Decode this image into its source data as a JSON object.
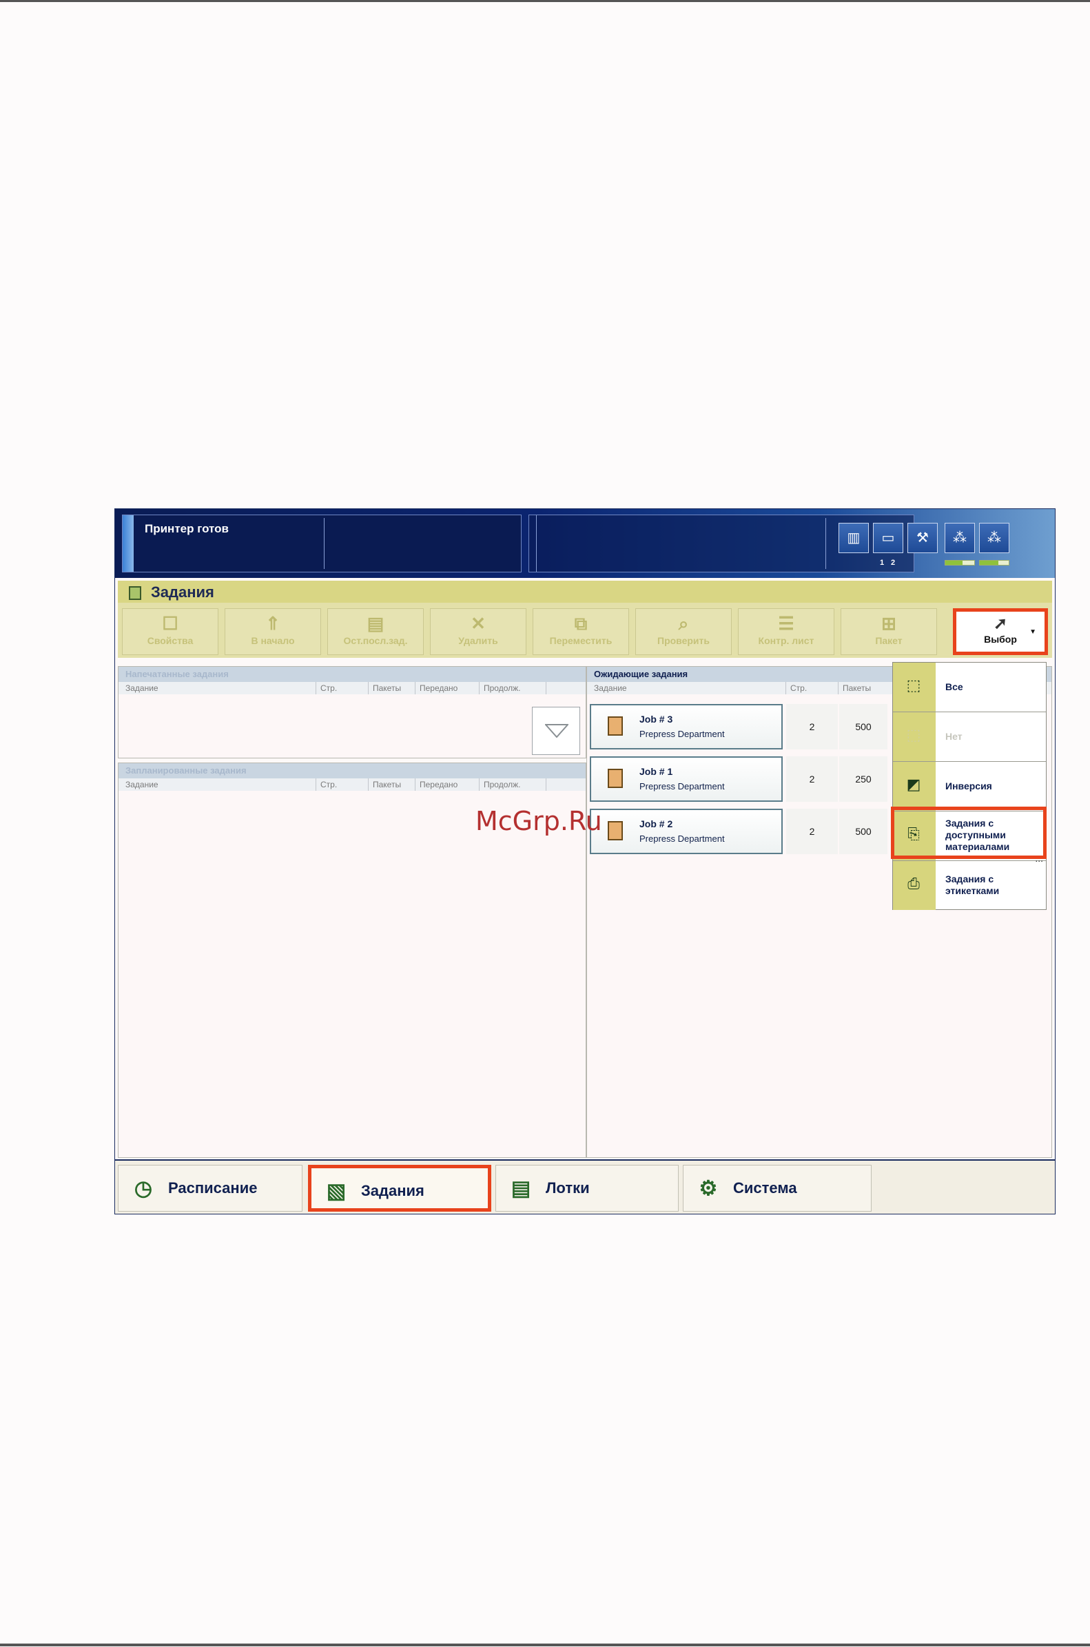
{
  "status": {
    "text": "Принтер готов",
    "tray_numbers": [
      "1",
      "2"
    ],
    "level_1": 0.6,
    "level_2": 0.65
  },
  "section": {
    "title": "Задания"
  },
  "toolbar": {
    "buttons": [
      {
        "label": "Свойства",
        "icon": "properties-icon"
      },
      {
        "label": "В начало",
        "icon": "to-top-icon"
      },
      {
        "label": "Ост.посл.зад.",
        "icon": "stop-after-job-icon"
      },
      {
        "label": "Удалить",
        "icon": "delete-icon"
      },
      {
        "label": "Переместить",
        "icon": "move-icon"
      },
      {
        "label": "Проверить",
        "icon": "check-icon"
      },
      {
        "label": "Контр. лист",
        "icon": "proof-sheet-icon"
      },
      {
        "label": "Пакет",
        "icon": "batch-icon"
      }
    ],
    "select": {
      "label": "Выбор",
      "icon": "cursor-icon"
    }
  },
  "printed": {
    "title": "Напечатанные задания",
    "columns": [
      "Задание",
      "Стр.",
      "Пакеты",
      "Передано",
      "Продолж."
    ]
  },
  "scheduled": {
    "title": "Запланированные задания",
    "columns": [
      "Задание",
      "Стр.",
      "Пакеты",
      "Передано",
      "Продолж."
    ]
  },
  "waiting": {
    "title": "Ожидающие задания",
    "columns": [
      "Задание",
      "Стр.",
      "Пакеты"
    ],
    "jobs": [
      {
        "name": "Job # 3",
        "dept": "Prepress Department",
        "pages": "2",
        "packs": "500"
      },
      {
        "name": "Job # 1",
        "dept": "Prepress Department",
        "pages": "2",
        "packs": "250"
      },
      {
        "name": "Job # 2",
        "dept": "Prepress Department",
        "pages": "2",
        "packs": "500"
      }
    ]
  },
  "dropdown": {
    "items": [
      {
        "label": "Все",
        "icon": "select-all-icon"
      },
      {
        "label": "Нет",
        "icon": "select-none-icon"
      },
      {
        "label": "Инверсия",
        "icon": "invert-selection-icon"
      },
      {
        "label": "Задания с доступными материалами",
        "icon": "available-media-icon"
      },
      {
        "label": "Задания с этикетками",
        "icon": "labels-icon"
      }
    ],
    "more": "..."
  },
  "nav": {
    "tabs": [
      {
        "label": "Расписание",
        "icon": "clock-icon"
      },
      {
        "label": "Задания",
        "icon": "jobs-icon"
      },
      {
        "label": "Лотки",
        "icon": "trays-icon"
      },
      {
        "label": "Система",
        "icon": "gears-icon"
      }
    ]
  },
  "watermark": "McGrp.Ru",
  "colors": {
    "highlight": "#e8431c",
    "accent": "#d9d684",
    "header": "#0a1c55"
  }
}
